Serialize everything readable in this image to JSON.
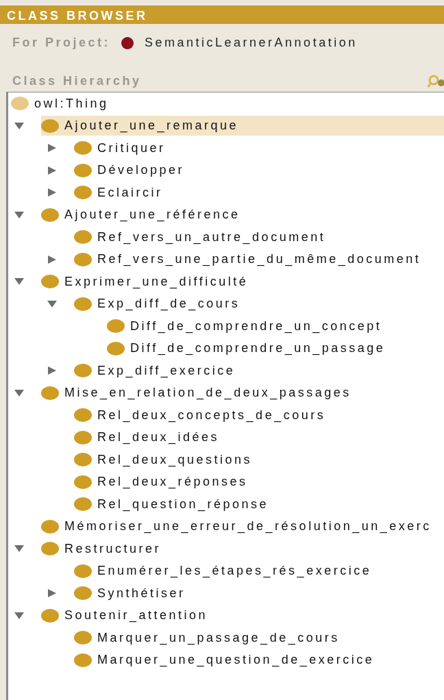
{
  "header": {
    "title": "CLASS BROWSER"
  },
  "project": {
    "label": "For Project:",
    "name": "SemanticLearnerAnnotation"
  },
  "hierarchy": {
    "title": "Class Hierarchy",
    "tree": [
      {
        "label": "owl:Thing",
        "kind": "root",
        "selected": false,
        "children": [
          {
            "label": "Ajouter_une_remarque",
            "kind": "branch",
            "expanded": true,
            "selected": true,
            "children": [
              {
                "label": "Critiquer",
                "kind": "branch",
                "expanded": false,
                "selected": false
              },
              {
                "label": "Développer",
                "kind": "branch",
                "expanded": false,
                "selected": false
              },
              {
                "label": "Eclaircir",
                "kind": "branch",
                "expanded": false,
                "selected": false
              }
            ]
          },
          {
            "label": "Ajouter_une_référence",
            "kind": "branch",
            "expanded": true,
            "selected": false,
            "children": [
              {
                "label": "Ref_vers_un_autre_document",
                "kind": "leaf",
                "selected": false
              },
              {
                "label": "Ref_vers_une_partie_du_même_document",
                "kind": "branch",
                "expanded": false,
                "selected": false
              }
            ]
          },
          {
            "label": "Exprimer_une_difficulté",
            "kind": "branch",
            "expanded": true,
            "selected": false,
            "children": [
              {
                "label": "Exp_diff_de_cours",
                "kind": "branch",
                "expanded": true,
                "selected": false,
                "children": [
                  {
                    "label": "Diff_de_comprendre_un_concept",
                    "kind": "leaf",
                    "selected": false
                  },
                  {
                    "label": "Diff_de_comprendre_un_passage",
                    "kind": "leaf",
                    "selected": false
                  }
                ]
              },
              {
                "label": "Exp_diff_exercice",
                "kind": "branch",
                "expanded": false,
                "selected": false
              }
            ]
          },
          {
            "label": "Mise_en_relation_de_deux_passages",
            "kind": "branch",
            "expanded": true,
            "selected": false,
            "children": [
              {
                "label": "Rel_deux_concepts_de_cours",
                "kind": "leaf",
                "selected": false
              },
              {
                "label": "Rel_deux_idées",
                "kind": "leaf",
                "selected": false
              },
              {
                "label": "Rel_deux_questions",
                "kind": "leaf",
                "selected": false
              },
              {
                "label": "Rel_deux_réponses",
                "kind": "leaf",
                "selected": false
              },
              {
                "label": "Rel_question_réponse",
                "kind": "leaf",
                "selected": false
              }
            ]
          },
          {
            "label": "Mémoriser_une_erreur_de_résolution_un_exerc",
            "kind": "leaf",
            "selected": false
          },
          {
            "label": "Restructurer",
            "kind": "branch",
            "expanded": true,
            "selected": false,
            "children": [
              {
                "label": "Enumérer_les_étapes_rés_exercice",
                "kind": "leaf",
                "selected": false
              },
              {
                "label": "Synthétiser",
                "kind": "branch",
                "expanded": false,
                "selected": false
              }
            ]
          },
          {
            "label": "Soutenir_attention",
            "kind": "branch",
            "expanded": true,
            "selected": false,
            "children": [
              {
                "label": "Marquer_un_passage_de_cours",
                "kind": "leaf",
                "selected": false
              },
              {
                "label": "Marquer_une_question_de_exercice",
                "kind": "leaf",
                "selected": false
              }
            ]
          }
        ]
      }
    ]
  }
}
